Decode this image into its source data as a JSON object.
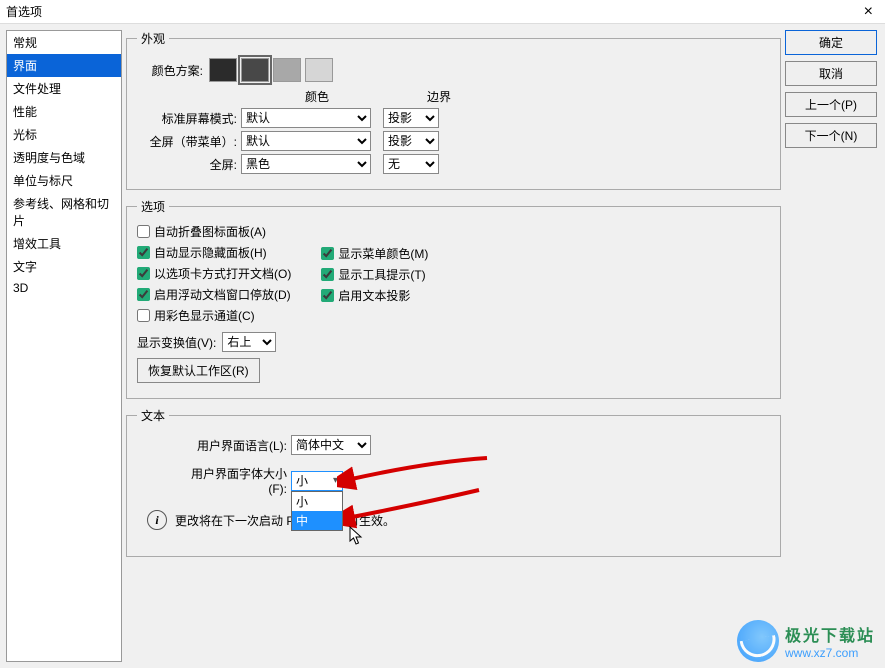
{
  "window": {
    "title": "首选项",
    "close": "×"
  },
  "buttons": {
    "ok": "确定",
    "cancel": "取消",
    "prev": "上一个(P)",
    "next": "下一个(N)"
  },
  "sidebar": {
    "items": [
      {
        "label": "常规"
      },
      {
        "label": "界面"
      },
      {
        "label": "文件处理"
      },
      {
        "label": "性能"
      },
      {
        "label": "光标"
      },
      {
        "label": "透明度与色域"
      },
      {
        "label": "单位与标尺"
      },
      {
        "label": "参考线、网格和切片"
      },
      {
        "label": "增效工具"
      },
      {
        "label": "文字"
      },
      {
        "label": "3D"
      }
    ],
    "active": 1
  },
  "appearance": {
    "legend": "外观",
    "scheme_label": "颜色方案:",
    "swatches": [
      "#2b2b2b",
      "#484848",
      "#a8a8a8",
      "#d6d6d6"
    ],
    "col_color": "颜色",
    "col_border": "边界",
    "rows": [
      {
        "label": "标准屏幕模式:",
        "color": "默认",
        "border": "投影"
      },
      {
        "label": "全屏（带菜单）:",
        "color": "默认",
        "border": "投影"
      },
      {
        "label": "全屏:",
        "color": "黑色",
        "border": "无"
      }
    ]
  },
  "options": {
    "legend": "选项",
    "left": [
      {
        "label": "自动折叠图标面板(A)",
        "checked": false
      },
      {
        "label": "自动显示隐藏面板(H)",
        "checked": true
      },
      {
        "label": "以选项卡方式打开文档(O)",
        "checked": true
      },
      {
        "label": "启用浮动文档窗口停放(D)",
        "checked": true
      },
      {
        "label": "用彩色显示通道(C)",
        "checked": false
      }
    ],
    "right": [
      {
        "label": "显示菜单颜色(M)",
        "checked": true
      },
      {
        "label": "显示工具提示(T)",
        "checked": true
      },
      {
        "label": "启用文本投影",
        "checked": true
      }
    ],
    "transform_label": "显示变换值(V):",
    "transform_value": "右上",
    "restore_btn": "恢复默认工作区(R)"
  },
  "text": {
    "legend": "文本",
    "lang_label": "用户界面语言(L):",
    "lang_value": "简体中文",
    "font_label": "用户界面字体大小(F):",
    "font_value": "小",
    "font_options": [
      "小",
      "中"
    ],
    "info": "更改将在下一次启动 Photoshop 时生效。"
  },
  "watermark": {
    "line1": "极光下载站",
    "line2": "www.xz7.com"
  }
}
